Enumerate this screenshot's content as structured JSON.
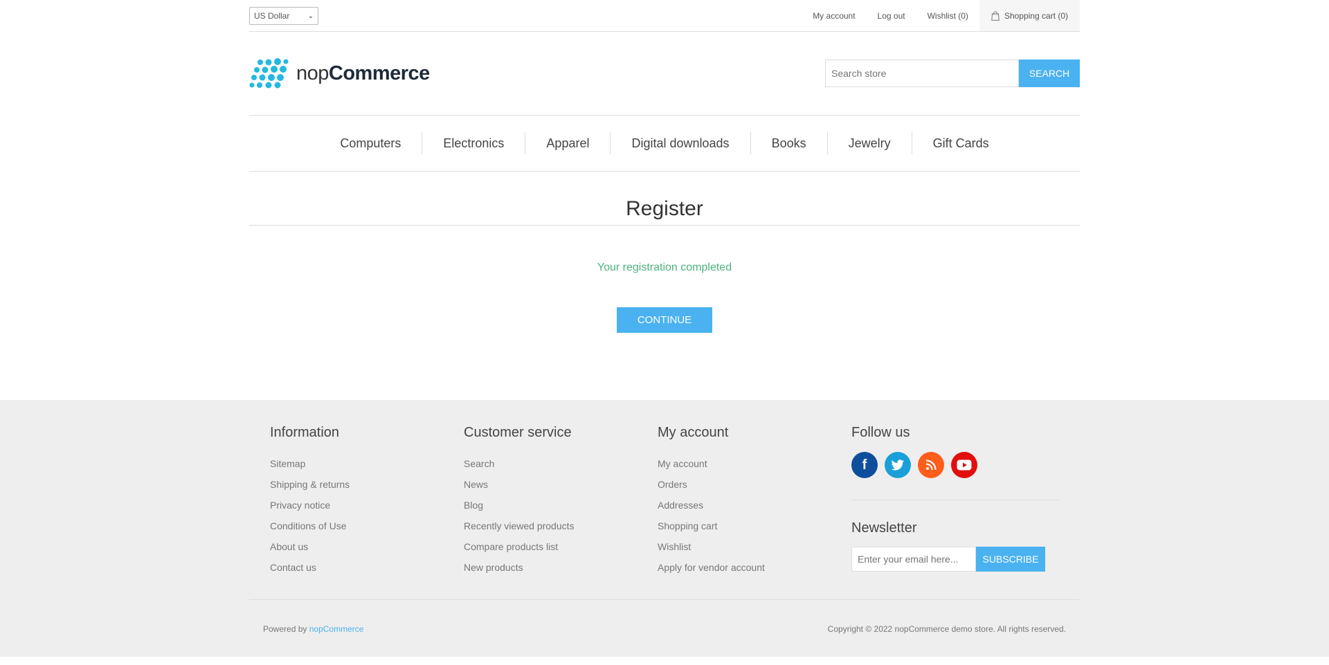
{
  "header": {
    "currency": "US Dollar",
    "links": {
      "my_account": "My account",
      "log_out": "Log out",
      "wishlist": "Wishlist (0)",
      "cart": "Shopping cart (0)"
    }
  },
  "logo": {
    "light": "nop",
    "bold": "Commerce"
  },
  "search": {
    "placeholder": "Search store",
    "button": "SEARCH"
  },
  "menu": [
    "Computers",
    "Electronics",
    "Apparel",
    "Digital downloads",
    "Books",
    "Jewelry",
    "Gift Cards"
  ],
  "page": {
    "title": "Register",
    "result": "Your registration completed",
    "continue": "CONTINUE"
  },
  "footer": {
    "information": {
      "title": "Information",
      "items": [
        "Sitemap",
        "Shipping & returns",
        "Privacy notice",
        "Conditions of Use",
        "About us",
        "Contact us"
      ]
    },
    "customer_service": {
      "title": "Customer service",
      "items": [
        "Search",
        "News",
        "Blog",
        "Recently viewed products",
        "Compare products list",
        "New products"
      ]
    },
    "my_account": {
      "title": "My account",
      "items": [
        "My account",
        "Orders",
        "Addresses",
        "Shopping cart",
        "Wishlist",
        "Apply for vendor account"
      ]
    },
    "follow": {
      "title": "Follow us",
      "icons": [
        "facebook-icon",
        "twitter-icon",
        "rss-icon",
        "youtube-icon"
      ]
    },
    "newsletter": {
      "title": "Newsletter",
      "placeholder": "Enter your email here...",
      "button": "SUBSCRIBE"
    },
    "powered_prefix": "Powered by",
    "powered_link": "nopCommerce",
    "copyright": "Copyright © 2022 nopCommerce demo store. All rights reserved."
  },
  "colors": {
    "accent": "#4ab2f1",
    "success": "#4cb17c",
    "footer_bg": "#eeeeee"
  }
}
